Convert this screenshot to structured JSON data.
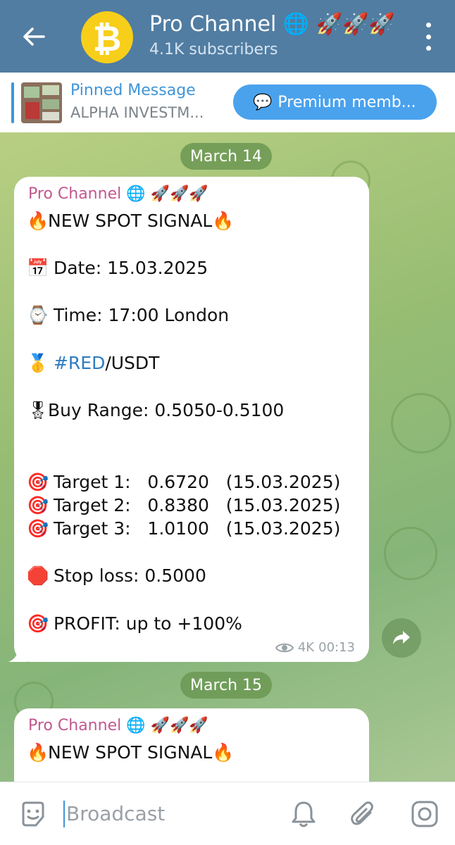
{
  "header": {
    "title": "Pro Channel 🌐 🚀🚀🚀",
    "subtitle": "4.1K subscribers"
  },
  "pinned": {
    "title": "Pinned Message",
    "text": "ALPHA INVESTM...",
    "button_icon": "💬",
    "button_label": "Premium memb..."
  },
  "messages": [
    {
      "date": "March 14",
      "sender": "Pro Channel 🌐 🚀🚀🚀",
      "lines": [
        {
          "icon": "🔥",
          "text": "NEW SPOT SIGNAL",
          "icon_after": "🔥"
        },
        {
          "icon": "📅",
          "text": "Date: 15.03.2025"
        },
        {
          "icon": "⌚",
          "text": "Time: 17:00 London"
        },
        {
          "icon": "🥇",
          "hashtag": "#RED",
          "text": "/USDT"
        },
        {
          "icon": "🎖",
          "text": "Buy Range: 0.5050-0.5100"
        },
        {
          "icon": "🎯",
          "text": "Target 1:   0.6720   (15.03.2025)"
        },
        {
          "icon": "🎯",
          "text": "Target 2:   0.8380   (15.03.2025)"
        },
        {
          "icon": "🎯",
          "text": "Target 3:   1.0100   (15.03.2025)"
        },
        {
          "icon": "🛑",
          "text": "Stop loss: 0.5000"
        },
        {
          "icon": "🎯",
          "text": "PROFIT: up to +100%"
        }
      ],
      "views": "4K",
      "time": "00:13"
    },
    {
      "date": "March 15",
      "sender": "Pro Channel 🌐 🚀🚀🚀",
      "lines": [
        {
          "icon": "🔥",
          "text": "NEW SPOT SIGNAL",
          "icon_after": "🔥"
        }
      ]
    }
  ],
  "composer": {
    "placeholder": "Broadcast"
  },
  "colors": {
    "header": "#517da2",
    "accent": "#3f95d8",
    "sender": "#c2588f",
    "hashtag": "#2e7bc2",
    "premium": "#4aa2ed"
  }
}
